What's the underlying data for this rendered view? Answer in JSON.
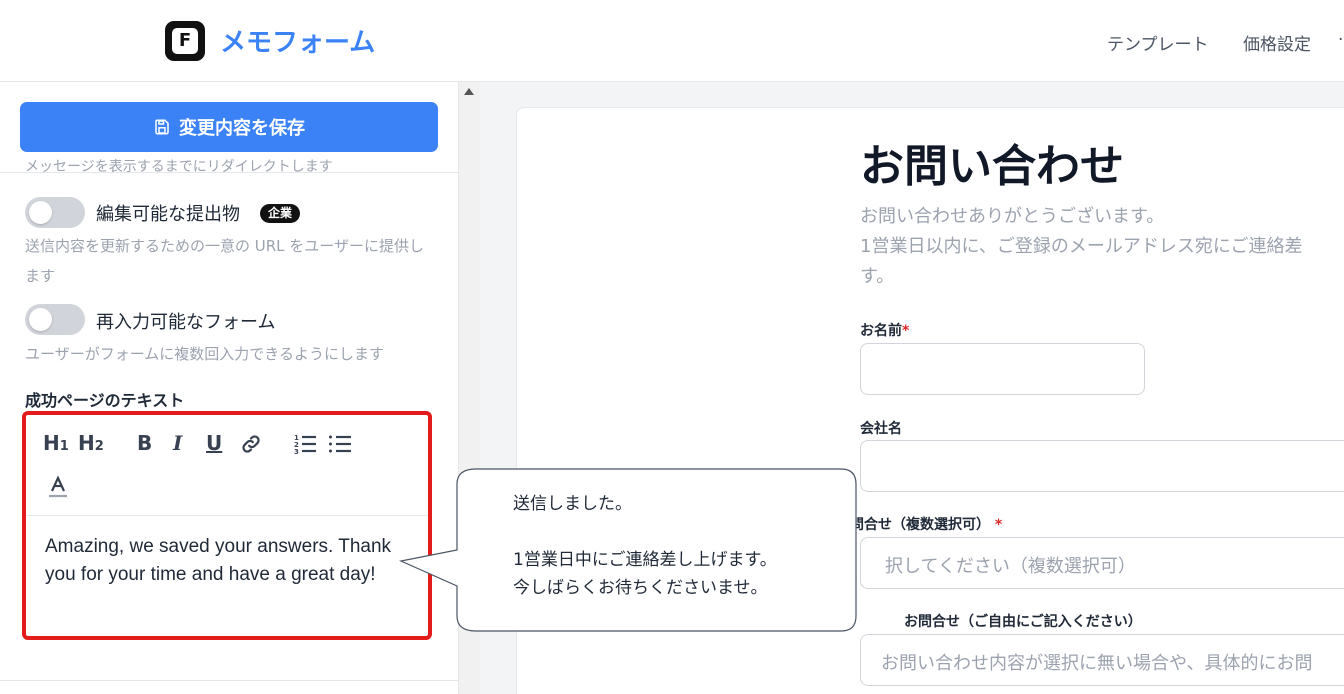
{
  "header": {
    "logo_letter": "F",
    "app_name": "メモフォーム",
    "nav": [
      "テンプレート",
      "価格設定",
      "·"
    ]
  },
  "sidebar": {
    "save_button_label": "変更内容を保存",
    "clipped_text": "メッセージを表示するまでにリダイレクトします",
    "options": [
      {
        "label": "編集可能な提出物",
        "badge": "企業",
        "description": "送信内容を更新するための一意の URL をユーザーに提供します",
        "enabled": false
      },
      {
        "label": "再入力可能なフォーム",
        "description": "ユーザーがフォームに複数回入力できるようにします",
        "enabled": false
      }
    ],
    "success_section_title": "成功ページのテキスト",
    "editor": {
      "toolbar": [
        "H1",
        "H2",
        "B",
        "I",
        "U",
        "link-icon",
        "ordered-list-icon",
        "bullet-list-icon",
        "text-color-icon"
      ],
      "content": "Amazing, we saved your answers. Thank you for your time and have a great day!"
    }
  },
  "preview": {
    "title": "お問い合わせ",
    "description_lines": [
      "お問い合わせありがとうございます。",
      "1営業日以内に、ご登録のメールアドレス宛にご連絡差",
      "す。"
    ],
    "fields": [
      {
        "label": "お名前",
        "required": true,
        "placeholder": ""
      },
      {
        "label": "会社名",
        "required": false,
        "placeholder": ""
      },
      {
        "label": "問合せ（複数選択可）",
        "required": true,
        "placeholder": "択してください（複数選択可）"
      },
      {
        "label": "お問合せ（ご自由にご記入ください）",
        "required": false,
        "placeholder": "お問い合わせ内容が選択に無い場合や、具体的にお問"
      }
    ]
  },
  "callout": {
    "lines": [
      "送信しました。",
      "",
      "1営業日中にご連絡差し上げます。",
      "今しばらくお待ちくださいませ。"
    ]
  },
  "colors": {
    "accent": "#3b82f6",
    "highlight": "#e31b1b",
    "required": "#dc2626"
  }
}
